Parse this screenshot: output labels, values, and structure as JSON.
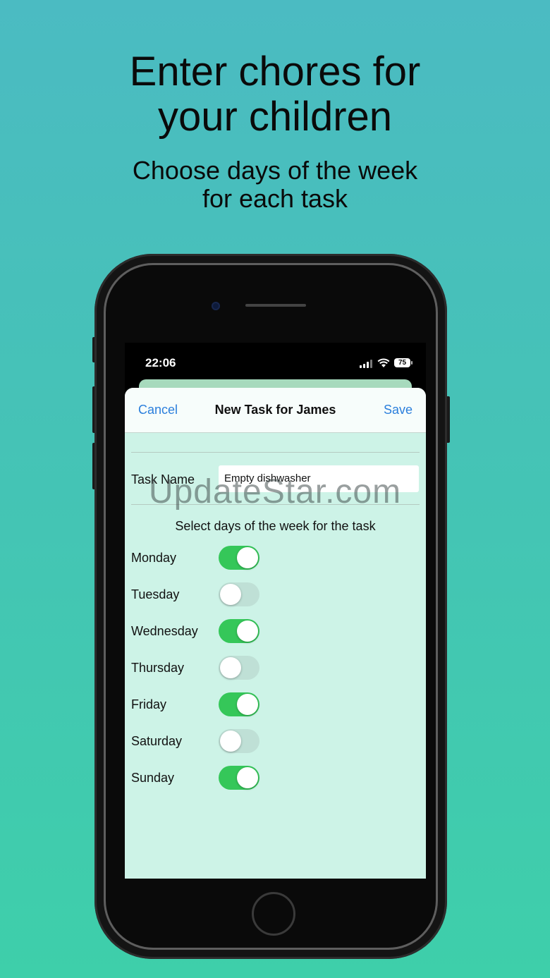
{
  "headline": {
    "line1": "Enter chores for",
    "line2": "your children"
  },
  "subline": {
    "line1": "Choose days of the week",
    "line2": "for each task"
  },
  "status_bar": {
    "time": "22:06",
    "battery": "75"
  },
  "nav": {
    "cancel": "Cancel",
    "title": "New Task for James",
    "save": "Save"
  },
  "task": {
    "label": "Task Name",
    "value": "Empty dishwasher"
  },
  "select_label": "Select days of the week for the task",
  "days": [
    {
      "label": "Monday",
      "on": true
    },
    {
      "label": "Tuesday",
      "on": false
    },
    {
      "label": "Wednesday",
      "on": true
    },
    {
      "label": "Thursday",
      "on": false
    },
    {
      "label": "Friday",
      "on": true
    },
    {
      "label": "Saturday",
      "on": false
    },
    {
      "label": "Sunday",
      "on": true
    }
  ],
  "watermark": "UpdateStar.com",
  "colors": {
    "accent": "#2b7fdc",
    "toggle_on": "#35c759",
    "sheet_bg": "#cdf3e7"
  }
}
